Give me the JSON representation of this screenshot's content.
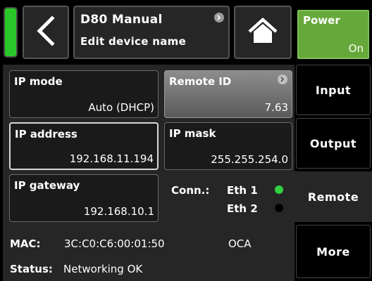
{
  "colors": {
    "status_led": "#28c828",
    "power_active": "#66a83a",
    "eth_connected": "#30d040",
    "eth_disconnected": "#000000"
  },
  "header": {
    "device_name": "D80 Manual",
    "subtitle": "Edit device name",
    "back_icon": "chevron-left-icon",
    "home_icon": "home-icon",
    "power": {
      "label": "Power",
      "state": "On"
    }
  },
  "fields": {
    "ip_mode": {
      "label": "IP mode",
      "value": "Auto (DHCP)"
    },
    "remote_id": {
      "label": "Remote ID",
      "value": "7.63"
    },
    "ip_address": {
      "label": "IP address",
      "value": "192.168.11.194"
    },
    "ip_mask": {
      "label": "IP mask",
      "value": "255.255.254.0"
    },
    "ip_gateway": {
      "label": "IP gateway",
      "value": "192.168.10.1"
    }
  },
  "connection": {
    "label": "Conn.:",
    "eth1": {
      "label": "Eth 1",
      "connected": true
    },
    "eth2": {
      "label": "Eth 2",
      "connected": false
    }
  },
  "info": {
    "mac_label": "MAC:",
    "mac_value": "3C:C0:C6:00:01:50",
    "protocol": "OCA",
    "status_label": "Status:",
    "status_value": "Networking OK"
  },
  "tabs": [
    {
      "label": "Input",
      "active": false
    },
    {
      "label": "Output",
      "active": false
    },
    {
      "label": "Remote",
      "active": true
    },
    {
      "label": "More",
      "active": false
    }
  ]
}
